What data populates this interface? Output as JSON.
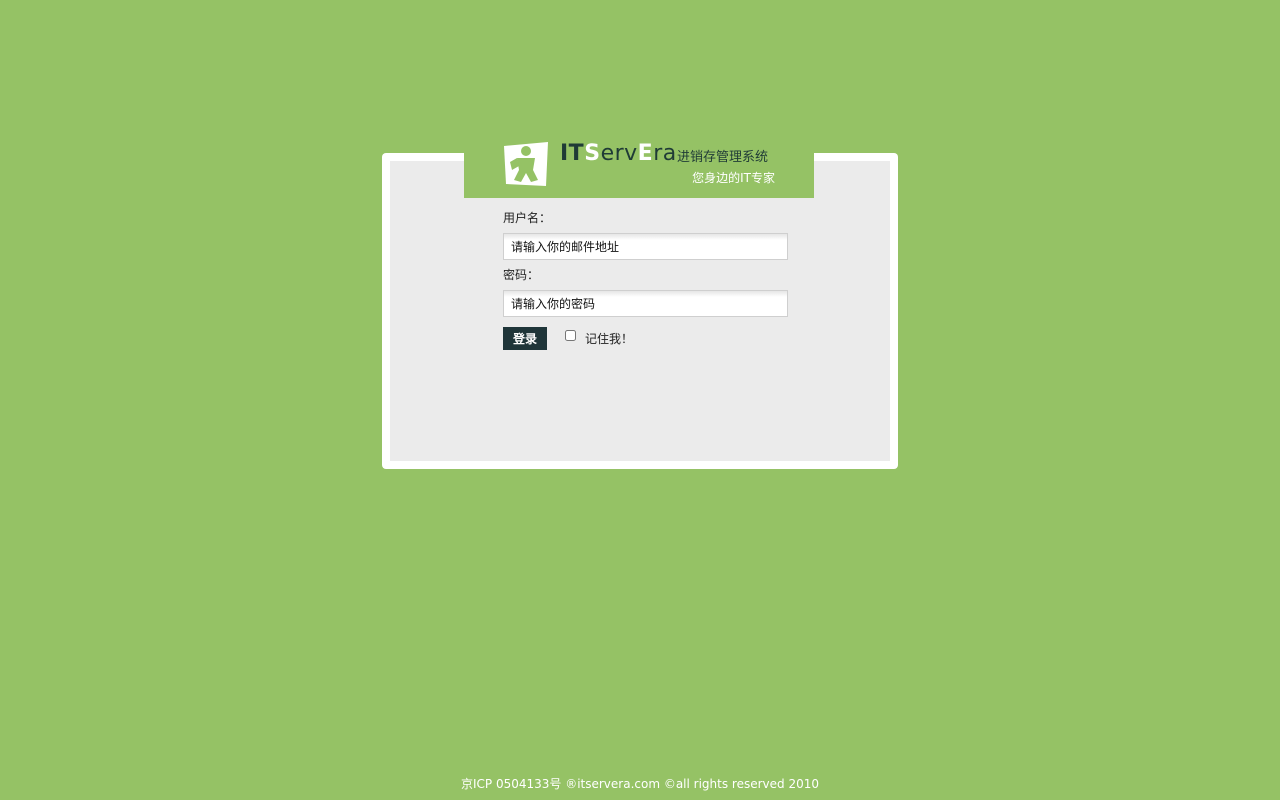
{
  "header": {
    "brand_part1": "IT",
    "brand_part2": "S",
    "brand_part3": "erv",
    "brand_part4": "E",
    "brand_part5": "ra",
    "system_name": "进销存管理系统",
    "slogan": "您身边的IT专家",
    "logo_icon": "person-figure-icon"
  },
  "form": {
    "username_label": "用户名：",
    "username_placeholder": "请输入你的邮件地址",
    "password_label": "密码：",
    "password_placeholder": "请输入你的密码",
    "login_label": "登录",
    "remember_label": "记住我！",
    "remember_checked": false
  },
  "footer": {
    "text": "京ICP 0504133号 ®itservera.com ©all rights reserved 2010"
  },
  "colors": {
    "background": "#95c265",
    "panel": "#ebebeb",
    "button": "#1f3539",
    "brand_dark": "#1f3b36"
  }
}
